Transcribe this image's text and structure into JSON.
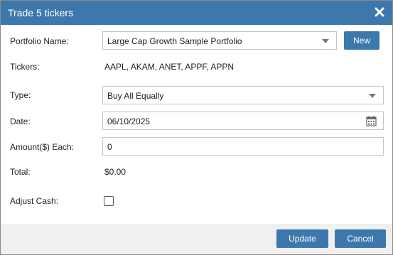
{
  "dialog": {
    "title": "Trade 5 tickers",
    "close_icon": "close-icon"
  },
  "form": {
    "portfolio_name": {
      "label": "Portfolio Name:",
      "value": "Large Cap Growth Sample Portfolio",
      "new_button": "New"
    },
    "tickers": {
      "label": "Tickers:",
      "value": "AAPL, AKAM, ANET, APPF, APPN"
    },
    "type": {
      "label": "Type:",
      "value": "Buy All Equally"
    },
    "date": {
      "label": "Date:",
      "value": "06/10/2025",
      "icon": "calendar-icon"
    },
    "amount_each": {
      "label": "Amount($) Each:",
      "value": "0"
    },
    "total": {
      "label": "Total:",
      "value": "$0.00"
    },
    "adjust_cash": {
      "label": "Adjust Cash:",
      "checked": false
    }
  },
  "footer": {
    "update_label": "Update",
    "cancel_label": "Cancel"
  },
  "colors": {
    "accent": "#3d78ad",
    "footer_bg": "#f0f0f0"
  }
}
